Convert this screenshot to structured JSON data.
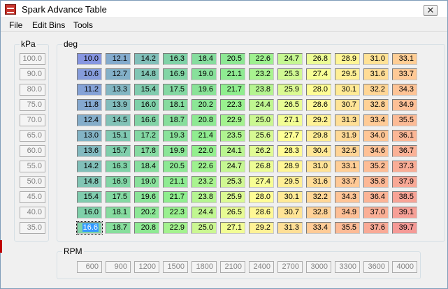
{
  "window": {
    "title": "Spark Advance Table",
    "close_glyph": "✕"
  },
  "menu": [
    "File",
    "Edit Bins",
    "Tools"
  ],
  "kpa": {
    "label": "kPa",
    "bins": [
      "100.0",
      "90.0",
      "80.0",
      "75.0",
      "70.0",
      "65.0",
      "60.0",
      "55.0",
      "50.0",
      "45.0",
      "40.0",
      "35.0"
    ]
  },
  "table": {
    "label": "deg",
    "rows": [
      [
        "10.0",
        "12.1",
        "14.2",
        "16.3",
        "18.4",
        "20.5",
        "22.6",
        "24.7",
        "26.8",
        "28.9",
        "31.0",
        "33.1"
      ],
      [
        "10.6",
        "12.7",
        "14.8",
        "16.9",
        "19.0",
        "21.1",
        "23.2",
        "25.3",
        "27.4",
        "29.5",
        "31.6",
        "33.7"
      ],
      [
        "11.2",
        "13.3",
        "15.4",
        "17.5",
        "19.6",
        "21.7",
        "23.8",
        "25.9",
        "28.0",
        "30.1",
        "32.2",
        "34.3"
      ],
      [
        "11.8",
        "13.9",
        "16.0",
        "18.1",
        "20.2",
        "22.3",
        "24.4",
        "26.5",
        "28.6",
        "30.7",
        "32.8",
        "34.9"
      ],
      [
        "12.4",
        "14.5",
        "16.6",
        "18.7",
        "20.8",
        "22.9",
        "25.0",
        "27.1",
        "29.2",
        "31.3",
        "33.4",
        "35.5"
      ],
      [
        "13.0",
        "15.1",
        "17.2",
        "19.3",
        "21.4",
        "23.5",
        "25.6",
        "27.7",
        "29.8",
        "31.9",
        "34.0",
        "36.1"
      ],
      [
        "13.6",
        "15.7",
        "17.8",
        "19.9",
        "22.0",
        "24.1",
        "26.2",
        "28.3",
        "30.4",
        "32.5",
        "34.6",
        "36.7"
      ],
      [
        "14.2",
        "16.3",
        "18.4",
        "20.5",
        "22.6",
        "24.7",
        "26.8",
        "28.9",
        "31.0",
        "33.1",
        "35.2",
        "37.3"
      ],
      [
        "14.8",
        "16.9",
        "19.0",
        "21.1",
        "23.2",
        "25.3",
        "27.4",
        "29.5",
        "31.6",
        "33.7",
        "35.8",
        "37.9"
      ],
      [
        "15.4",
        "17.5",
        "19.6",
        "21.7",
        "23.8",
        "25.9",
        "28.0",
        "30.1",
        "32.2",
        "34.3",
        "36.4",
        "38.5"
      ],
      [
        "16.0",
        "18.1",
        "20.2",
        "22.3",
        "24.4",
        "26.5",
        "28.6",
        "30.7",
        "32.8",
        "34.9",
        "37.0",
        "39.1"
      ],
      [
        "16.6",
        "18.7",
        "20.8",
        "22.9",
        "25.0",
        "27.1",
        "29.2",
        "31.3",
        "33.4",
        "35.5",
        "37.6",
        "39.7"
      ]
    ],
    "selected_cell": [
      11,
      0
    ],
    "color_stops": [
      "#8796e1",
      "#7fd0a9",
      "#91ef8e",
      "#ffff96",
      "#ffc896",
      "#f59a96"
    ]
  },
  "rpm": {
    "label": "RPM",
    "bins": [
      "600",
      "900",
      "1200",
      "1500",
      "1800",
      "2100",
      "2400",
      "2700",
      "3000",
      "3300",
      "3600",
      "4000"
    ]
  }
}
